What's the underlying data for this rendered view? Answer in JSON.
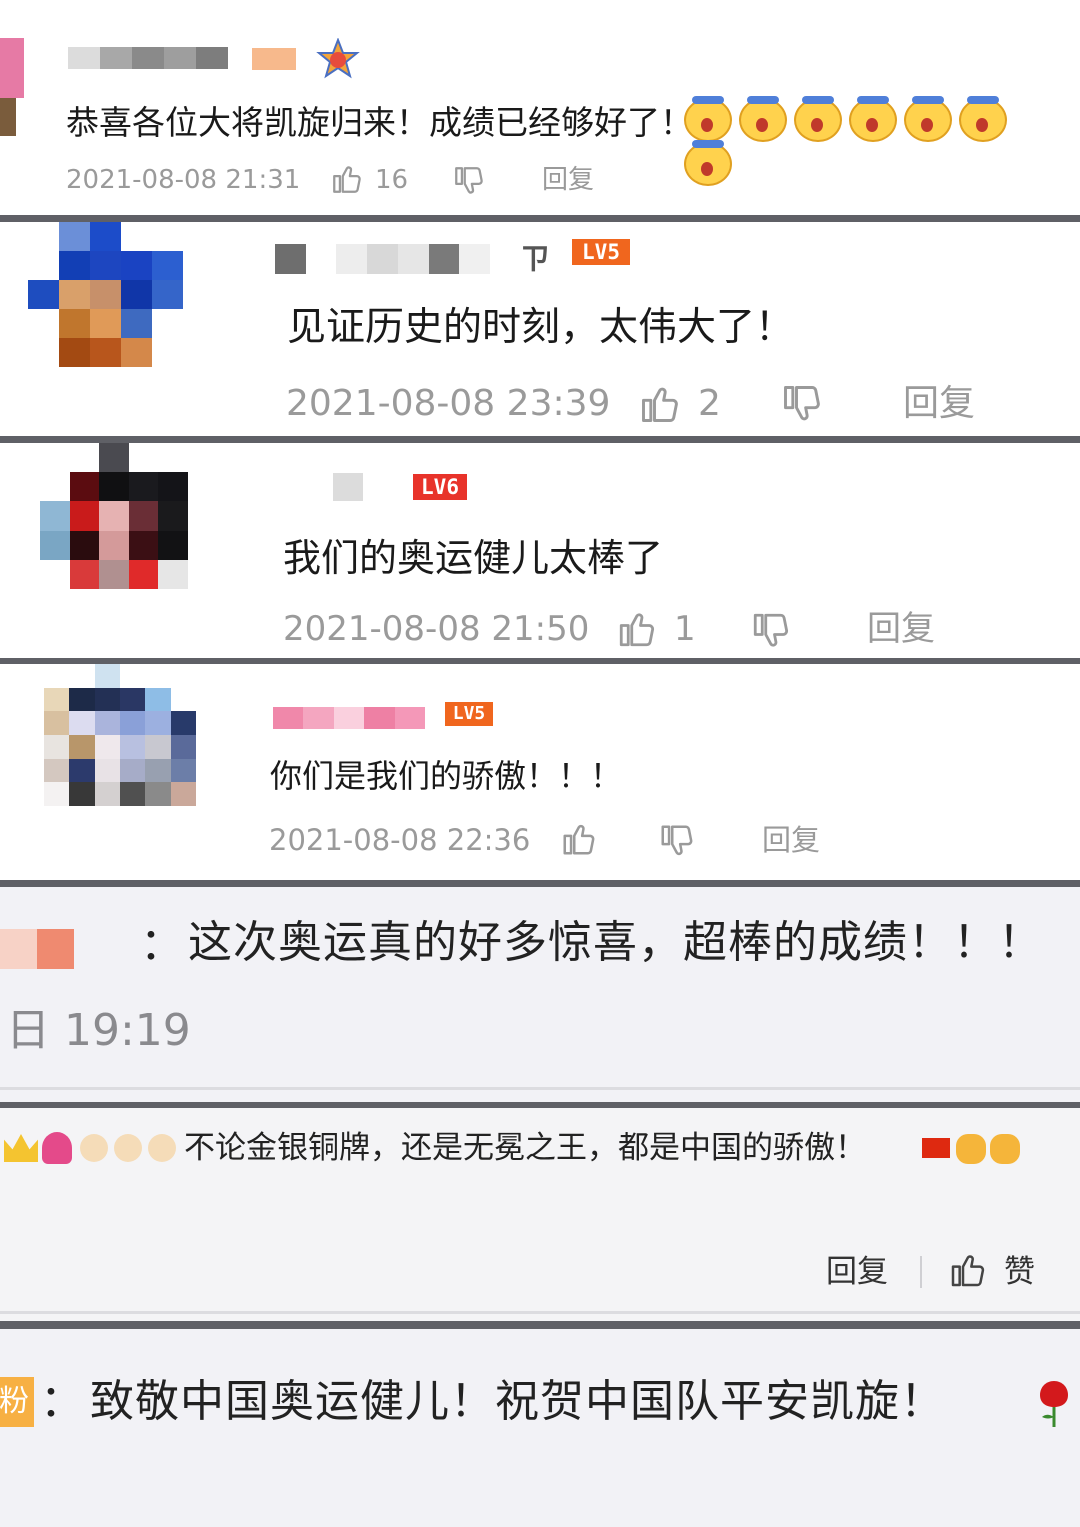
{
  "comments": [
    {
      "text": "恭喜各位大将凯旋归来！成绩已经够好了！",
      "time": "2021-08-08 21:31",
      "likes": "16",
      "reply": "回复"
    },
    {
      "level": "LV5",
      "text": "见证历史的时刻，太伟大了！",
      "time": "2021-08-08 23:39",
      "likes": "2",
      "reply": "回复"
    },
    {
      "level": "LV6",
      "text": "我们的奥运健儿太棒了",
      "time": "2021-08-08 21:50",
      "likes": "1",
      "reply": "回复"
    },
    {
      "level": "LV5",
      "text": "你们是我们的骄傲！！！",
      "time": "2021-08-08 22:36",
      "reply": "回复"
    },
    {
      "colon": "：",
      "text": "这次奥运真的好多惊喜，超棒的成绩！！！",
      "time": "日 19:19"
    },
    {
      "text": "不论金银铜牌，还是无冕之王，都是中国的骄傲！",
      "reply": "回复",
      "like": "赞"
    },
    {
      "badge": "粉",
      "colon": "：",
      "text": "致敬中国奥运健儿！祝贺中国队平安凯旋！"
    }
  ],
  "colors": {
    "separator": "#5f6066",
    "meta": "#9a9a9a",
    "level_badge": "#f0661e",
    "panel_gray": "#f2f2f6"
  }
}
